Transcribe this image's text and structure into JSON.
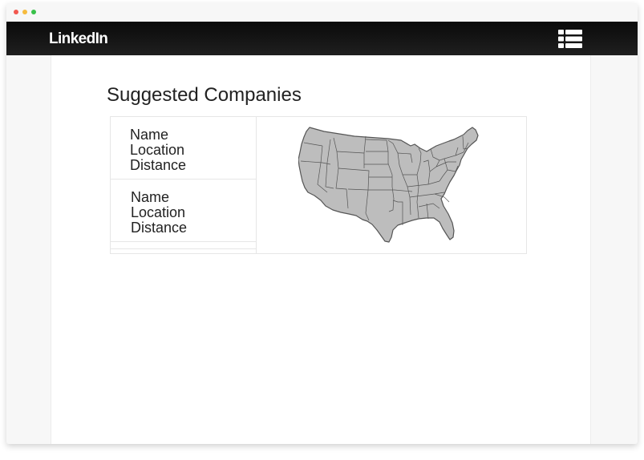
{
  "window": {
    "traffic_lights": [
      "close",
      "minimize",
      "maximize"
    ]
  },
  "navbar": {
    "brand": "LinkedIn",
    "menu_icon": "list-menu-icon"
  },
  "main": {
    "section_title": "Suggested Companies",
    "companies": [
      {
        "name": "Name",
        "location": "Location",
        "distance": "Distance"
      },
      {
        "name": "Name",
        "location": "Location",
        "distance": "Distance"
      }
    ],
    "map_icon": "us-map-icon"
  },
  "colors": {
    "navbar": "#111111",
    "map_fill": "#bdbdbd",
    "map_stroke": "#555555",
    "border": "#e6e6e6"
  }
}
